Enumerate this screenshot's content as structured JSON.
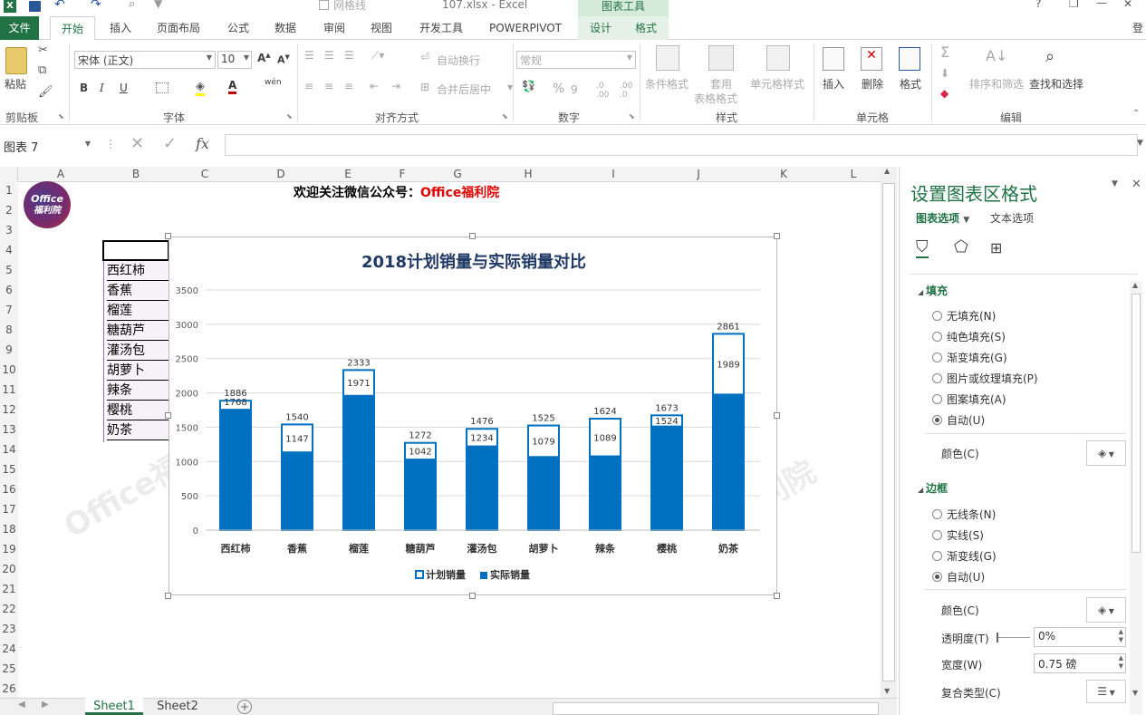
{
  "window": {
    "file_name": "107.xlsx - Excel",
    "context_title": "图表工具",
    "login": "登"
  },
  "quick_access": {
    "gridlines_label": "网格线"
  },
  "tabs": [
    "文件",
    "开始",
    "插入",
    "页面布局",
    "公式",
    "数据",
    "审阅",
    "视图",
    "开发工具",
    "POWERPIVOT",
    "设计",
    "格式"
  ],
  "ribbon": {
    "clipboard": {
      "paste": "粘贴",
      "label": "剪贴板"
    },
    "font": {
      "name": "宋体 (正文)",
      "size": "10",
      "label": "字体",
      "bold": "B",
      "italic": "I",
      "underline": "U",
      "phonetic": "wén"
    },
    "alignment": {
      "wrap": "自动换行",
      "merge": "合并后居中",
      "label": "对齐方式"
    },
    "number": {
      "format": "常规",
      "percent": "%",
      "comma": "9",
      "label": "数字"
    },
    "styles": {
      "conditional": "条件格式",
      "table_a": "套用",
      "table_b": "表格格式",
      "cell_styles": "单元格样式",
      "label": "样式"
    },
    "cells": {
      "insert": "插入",
      "delete": "删除",
      "format": "格式",
      "label": "单元格"
    },
    "editing": {
      "sort": "排序和筛选",
      "find": "查找和选择",
      "label": "编辑"
    }
  },
  "formula_bar": {
    "name_box": "图表 7",
    "fx": "fx",
    "cancel": "✕",
    "enter": "✓"
  },
  "columns": [
    "A",
    "B",
    "C",
    "D",
    "E",
    "F",
    "G",
    "H",
    "I",
    "J",
    "K",
    "L"
  ],
  "rows": [
    "1",
    "2",
    "3",
    "4",
    "5",
    "6",
    "7",
    "8",
    "9",
    "10",
    "11",
    "12",
    "13",
    "14",
    "15",
    "16",
    "17",
    "18",
    "19",
    "20",
    "21",
    "22",
    "23",
    "24",
    "25",
    "26"
  ],
  "sheet": {
    "header_text": "欢迎关注微信公众号：",
    "header_brand": "Office福利院",
    "logo_line1": "Office",
    "logo_line2": "福利院",
    "watermark": "Office福利院",
    "items": [
      "西红柿",
      "香蕉",
      "榴莲",
      "糖葫芦",
      "灌汤包",
      "胡萝卜",
      "辣条",
      "樱桃",
      "奶茶"
    ]
  },
  "chart_data": {
    "type": "bar",
    "title": "2018计划销量与实际销量对比",
    "categories": [
      "西红柿",
      "香蕉",
      "榴莲",
      "糖葫芦",
      "灌汤包",
      "胡萝卜",
      "辣条",
      "樱桃",
      "奶茶"
    ],
    "series": [
      {
        "name": "计划销量",
        "values": [
          1886,
          1540,
          2333,
          1272,
          1476,
          1525,
          1624,
          1673,
          2861
        ]
      },
      {
        "name": "实际销量",
        "values": [
          1768,
          1147,
          1971,
          1042,
          1234,
          1079,
          1089,
          1524,
          1989
        ]
      }
    ],
    "yticks": [
      "0",
      "500",
      "1000",
      "1500",
      "2000",
      "2500",
      "3000",
      "3500"
    ],
    "ylim": [
      0,
      3500
    ],
    "grid": true,
    "legend": "bottom",
    "colors": {
      "plan_border": "#0070c0",
      "actual_fill": "#0070c0",
      "title": "#1f3864"
    }
  },
  "pane": {
    "title": "设置图表区格式",
    "tab_chart": "图表选项",
    "tab_text": "文本选项",
    "fill_section": "填充",
    "fill_options": [
      "无填充(N)",
      "纯色填充(S)",
      "渐变填充(G)",
      "图片或纹理填充(P)",
      "图案填充(A)",
      "自动(U)"
    ],
    "fill_color": "颜色(C)",
    "border_section": "边框",
    "border_options": [
      "无线条(N)",
      "实线(S)",
      "渐变线(G)",
      "自动(U)"
    ],
    "border_color": "颜色(C)",
    "transparency_label": "透明度(T)",
    "transparency_value": "0%",
    "width_label": "宽度(W)",
    "width_value": "0.75 磅",
    "compound_label": "复合类型(C)"
  },
  "sheets": [
    "Sheet1",
    "Sheet2"
  ],
  "colors": {
    "excel_green": "#217346",
    "chart_blue": "#0070c0",
    "brand_red": "#e00000"
  }
}
